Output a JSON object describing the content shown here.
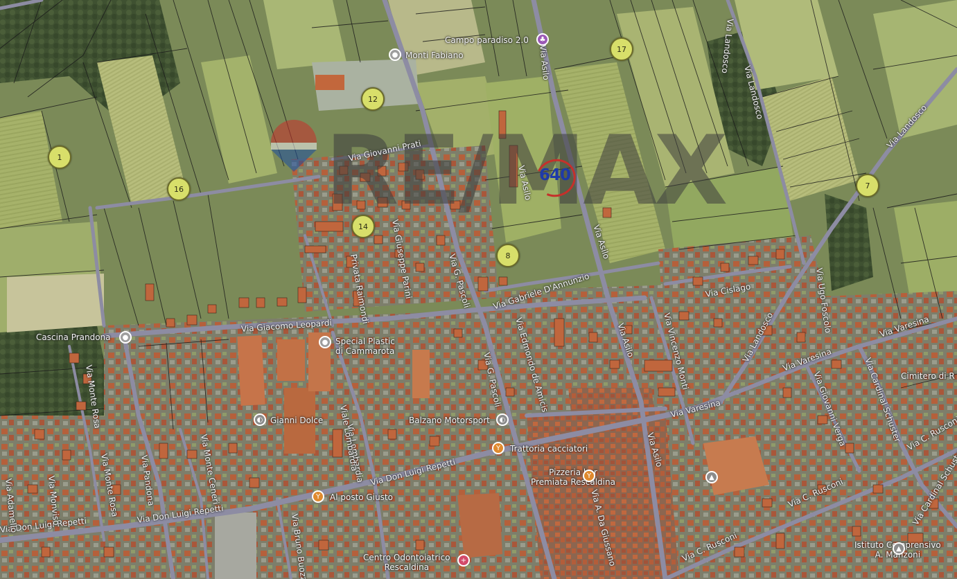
{
  "watermark": {
    "brand": "RE/MAX",
    "text": "RE/MAX",
    "reference": "640"
  },
  "colors": {
    "marker_fill": "#d8df6a",
    "marker_border": "#6b6b2a",
    "reference_text": "#1e3aa8",
    "reference_ring": "#c5302b",
    "road": "#8b8aa0"
  },
  "markers": [
    {
      "label": "1"
    },
    {
      "label": "16"
    },
    {
      "label": "12"
    },
    {
      "label": "14"
    },
    {
      "label": "8"
    },
    {
      "label": "17"
    },
    {
      "label": "7"
    }
  ],
  "pois": [
    {
      "name": "Monti Fabiano",
      "icon": "location-pin-icon"
    },
    {
      "name": "Campo paradiso 2.0",
      "icon": "park-pin-icon"
    },
    {
      "name": "Cascina Prandona",
      "icon": "location-pin-icon"
    },
    {
      "name_line1": "Special Plastic",
      "name_line2": "di Cammarota",
      "icon": "location-pin-icon"
    },
    {
      "name": "Gianni Dolce",
      "icon": "shop-pin-icon"
    },
    {
      "name": "Balzano Motorsport",
      "icon": "shop-pin-icon"
    },
    {
      "name": "Trattoria cacciatori",
      "icon": "restaurant-pin-icon"
    },
    {
      "name_line1": "Pizzeria bar",
      "name_line2": "Premiata Rescaldina",
      "icon": "restaurant-pin-icon"
    },
    {
      "name": "Al posto Giusto",
      "icon": "restaurant-pin-icon"
    },
    {
      "name_line1": "Centro Odontoiatrico",
      "name_line2": "Rescaldina",
      "icon": "hospital-pin-icon"
    },
    {
      "name_line1": "Istituto Comprensivo",
      "name_line2": "A. Manzoni",
      "icon": "school-pin-icon"
    },
    {
      "name": "Cimitero di R",
      "icon": ""
    }
  ],
  "streets": [
    "Via Giovanni Prati",
    "Via Asilo",
    "Via Asilo",
    "Via Asilo",
    "Via Asilo",
    "Via Asilo",
    "Via Landosco",
    "Via Landosco",
    "Via Landosco",
    "Via Landosco",
    "Via Giacomo Leopardi",
    "Via Gabriele D'Annunzio",
    "Via G. Pascoli",
    "Via G. Pascoli",
    "Via Edmondo de Amicis",
    "Via Vincenzo Monti",
    "Via Cislago",
    "Via Varesina",
    "Via Varesina",
    "Via Varesina",
    "Via Giovanni Verga",
    "Via Cardinal Schuster",
    "Via Cardinal Schuster",
    "Via C. Rusconi",
    "Via C. Rusconi",
    "Via C. Rusconi",
    "Via Don Luigi Repetti",
    "Via Don Luigi Repetti",
    "Via Don Luigi Repetti",
    "Via Lombardia",
    "Via Monte Ceneri",
    "Via Pandona",
    "Via Monviso",
    "Via Adamello",
    "Via Monte Rosa",
    "Via Monte Rosa",
    "Via Bruno Buozzi",
    "Via A. Da Giussano",
    "Privata Raimondi",
    "Via Giuseppe Parini",
    "Viale Lombardia",
    "Via Ugo Foscolo"
  ]
}
